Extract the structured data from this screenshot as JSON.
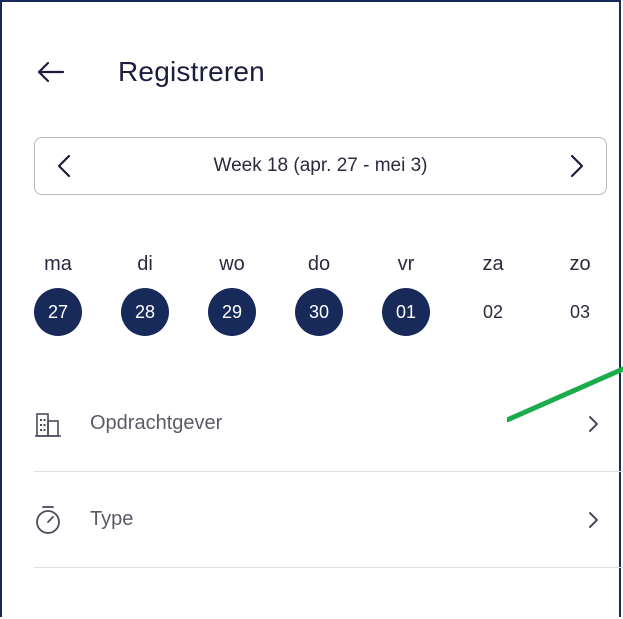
{
  "header": {
    "back_icon": "arrow-left-icon",
    "title": "Registreren"
  },
  "week_selector": {
    "label": "Week 18 (apr. 27 - mei 3)",
    "prev_icon": "chevron-left-icon",
    "next_icon": "chevron-right-icon"
  },
  "days": [
    {
      "name": "ma",
      "number": "27",
      "selected": true
    },
    {
      "name": "di",
      "number": "28",
      "selected": true
    },
    {
      "name": "wo",
      "number": "29",
      "selected": true
    },
    {
      "name": "do",
      "number": "30",
      "selected": true
    },
    {
      "name": "vr",
      "number": "01",
      "selected": true
    },
    {
      "name": "za",
      "number": "02",
      "selected": false
    },
    {
      "name": "zo",
      "number": "03",
      "selected": false
    }
  ],
  "list": [
    {
      "label": "Opdrachtgever",
      "icon": "building-icon",
      "chevron": "chevron-right-icon"
    },
    {
      "label": "Type",
      "icon": "stopwatch-icon",
      "chevron": "chevron-right-icon"
    }
  ],
  "colors": {
    "accent": "#172a5a",
    "annotation": "#1aab4b",
    "divider": "#dedee4"
  }
}
